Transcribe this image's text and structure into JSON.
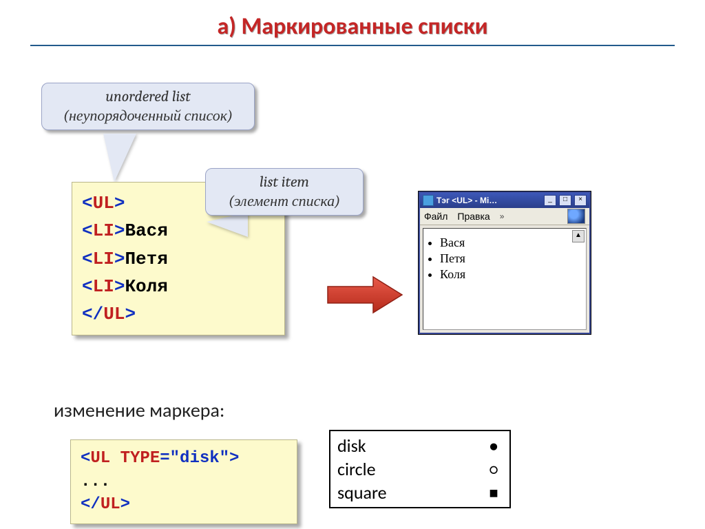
{
  "heading": "а) Маркированные списки",
  "callout1_line1": "unordered list",
  "callout1_line2": "(неупорядоченный список)",
  "callout2_line1": "list item",
  "callout2_line2": "(элемент списка)",
  "code1": {
    "t1a": "<",
    "t1b": "UL",
    "t1c": ">",
    "t2a": "<",
    "t2b": "LI",
    "t2c": ">",
    "t2d": "Вася",
    "t3a": "<",
    "t3b": "LI",
    "t3c": ">",
    "t3d": "Петя",
    "t4a": "<",
    "t4b": "LI",
    "t4c": ">",
    "t4d": "Коля",
    "t5a": "</",
    "t5b": "UL",
    "t5c": ">"
  },
  "browser": {
    "title": "Тэг <UL> - Mi…",
    "menu_file": "Файл",
    "menu_edit": "Правка",
    "chev": "»",
    "min": "_",
    "max": "□",
    "close": "×",
    "scroll_up": "▲",
    "items": {
      "i1": "Вася",
      "i2": "Петя",
      "i3": "Коля"
    }
  },
  "subhead": "изменение маркера:",
  "code2": {
    "l1a": "<",
    "l1b": "UL",
    "l1c": " ",
    "l1d": "TYPE",
    "l1e": "=\"disk\">",
    "l2": "...",
    "l3a": "</",
    "l3b": "UL",
    "l3c": ">"
  },
  "markers": {
    "m1": "disk",
    "g1": "●",
    "m2": "circle",
    "g2": "○",
    "m3": "square",
    "g3": "■"
  }
}
